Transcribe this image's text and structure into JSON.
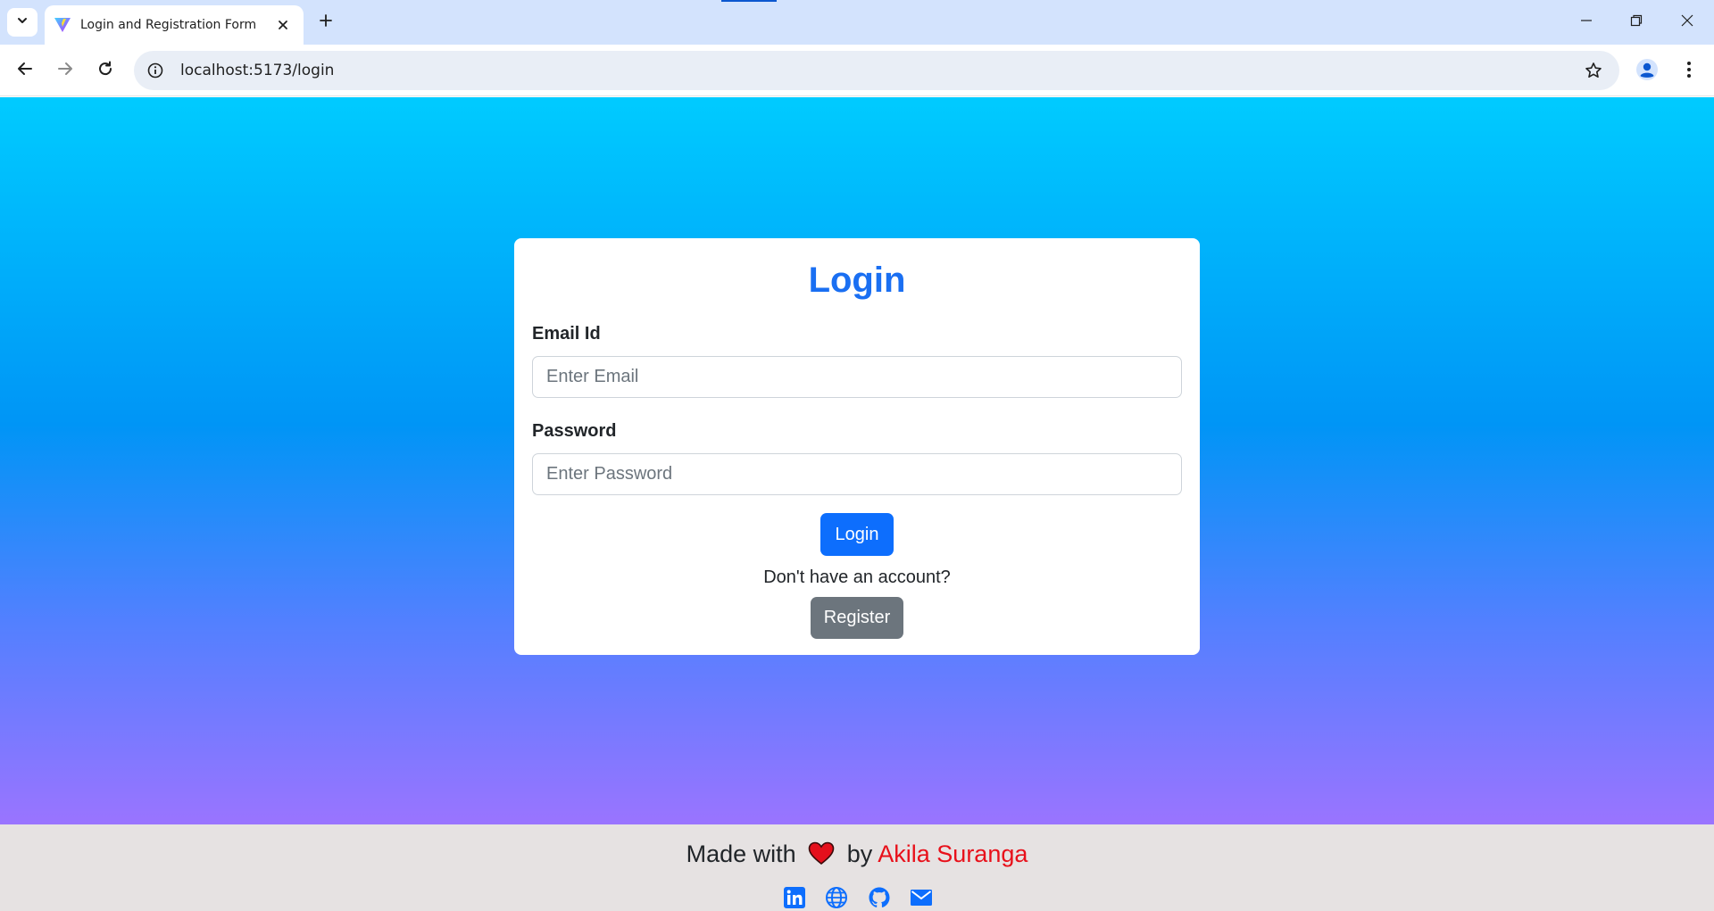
{
  "browser": {
    "tab_title": "Login and Registration Form",
    "url": "localhost:5173/login"
  },
  "icons": {
    "tab_search": "chevron-down-icon",
    "favicon": "vite-logo-icon",
    "tab_close": "close-icon",
    "new_tab": "plus-icon",
    "back": "arrow-left-icon",
    "forward": "arrow-right-icon",
    "reload": "reload-icon",
    "site_info": "info-icon",
    "bookmark": "star-icon",
    "profile": "person-icon",
    "menu": "kebab-menu-icon",
    "minimize": "minimize-icon",
    "restore": "restore-icon",
    "close_window": "close-icon",
    "heart": "heart-icon",
    "social": [
      "linkedin-icon",
      "globe-icon",
      "github-icon",
      "mail-icon"
    ]
  },
  "login_card": {
    "title": "Login",
    "email_label": "Email Id",
    "email_placeholder": "Enter Email",
    "email_value": "",
    "password_label": "Password",
    "password_placeholder": "Enter Password",
    "password_value": "",
    "login_button": "Login",
    "no_account_text": "Don't have an account?",
    "register_button": "Register"
  },
  "footer": {
    "made_with": "Made with",
    "by": "by",
    "author": "Akila Suranga"
  },
  "colors": {
    "gradient_top": "#00cbff",
    "gradient_mid": "#0095f6",
    "gradient_bottom": "#9a74ff",
    "title_blue": "#1a6ff2",
    "login_button": "#0d6efd",
    "register_button": "#6c757d",
    "author_red": "#e8101a",
    "footer_bg": "#e6e2e2"
  }
}
